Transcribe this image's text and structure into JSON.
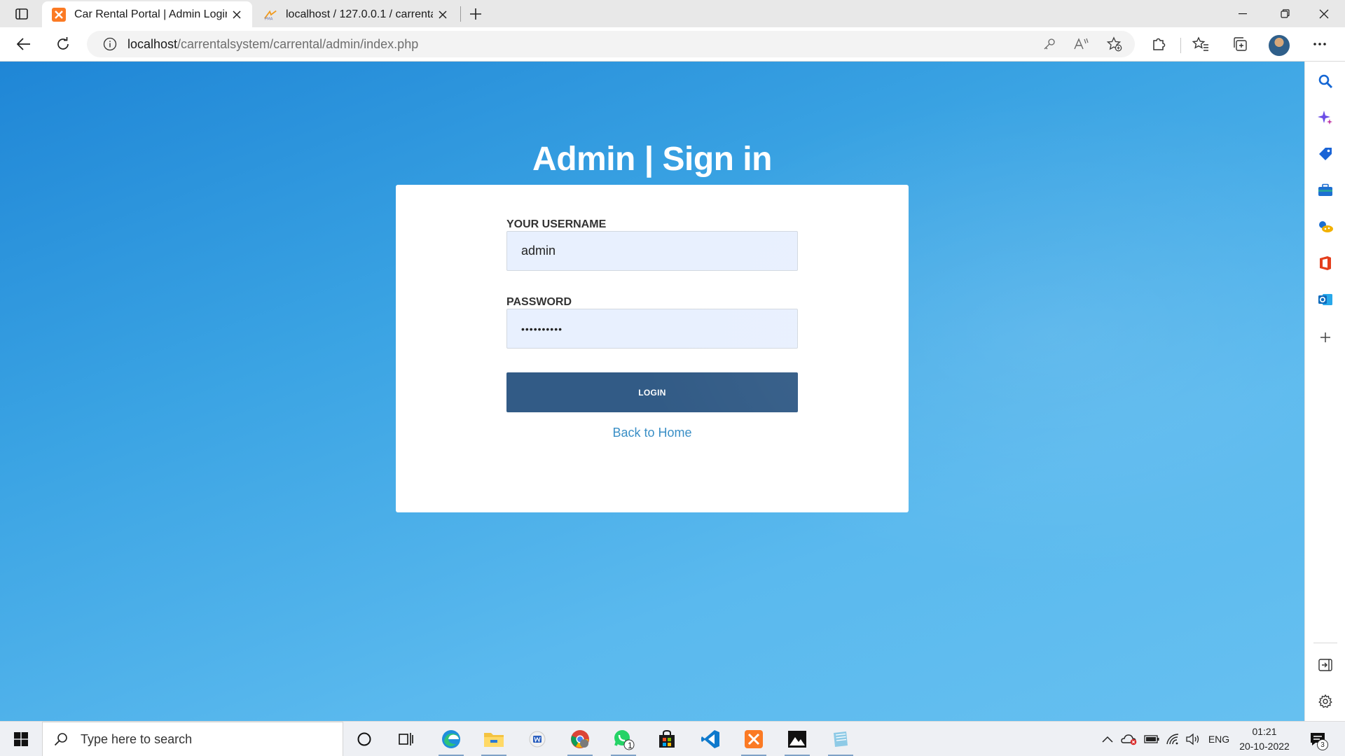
{
  "browser": {
    "tabs": [
      {
        "title": "Car Rental Portal | Admin Login",
        "active": true,
        "favicon": "xampp-icon"
      },
      {
        "title": "localhost / 127.0.0.1 / carrental /",
        "active": false,
        "favicon": "phpmyadmin-icon"
      }
    ],
    "address_bar": {
      "host": "localhost",
      "path": "/carrentalsystem/carrental/admin/index.php"
    }
  },
  "page": {
    "heading": "Admin | Sign in",
    "username_label": "YOUR USERNAME",
    "username_value": "admin",
    "password_label": "PASSWORD",
    "password_value": "••••••••••",
    "login_button": "LOGIN",
    "back_link": "Back to Home",
    "background_color": "#3aa3e3",
    "button_color": "#325b86"
  },
  "taskbar": {
    "search_placeholder": "Type here to search",
    "language": "ENG",
    "time": "01:21",
    "date": "20-10-2022",
    "notification_count": "3",
    "whatsapp_badge": "1"
  }
}
